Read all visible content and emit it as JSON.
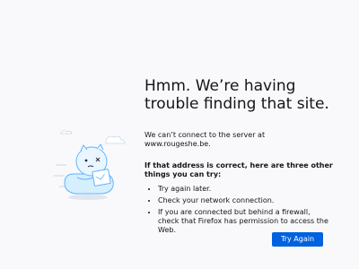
{
  "window": {
    "title": "Hmm. We’re having trouble finding that site."
  },
  "error": {
    "title": "Hmm. We’re having trouble finding that site.",
    "description": "We can’t connect to the server at www.rougeshe.be.",
    "subheading": "If that address is correct, here are three other things you can try:",
    "tips": [
      "Try again later.",
      "Check your network connection.",
      "If you are connected but behind a firewall, check that Firefox has permission to access the Web."
    ]
  },
  "actions": {
    "try_again_label": "Try Again"
  },
  "illustration": {
    "icon": "confused-cloud-character-icon"
  },
  "colors": {
    "background": "#f9f9fb",
    "text": "#15141a",
    "button": "#0061e0",
    "button_text": "#ffffff",
    "illustration_fill": "#d6efff",
    "illustration_stroke": "#5cb3ff"
  }
}
